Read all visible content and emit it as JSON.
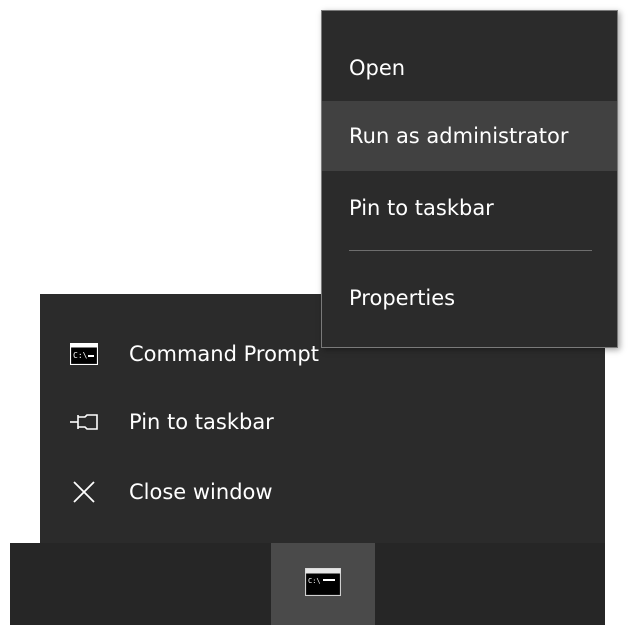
{
  "context_menu": {
    "items": [
      {
        "label": "Open"
      },
      {
        "label": "Run as administrator"
      },
      {
        "label": "Pin to taskbar"
      },
      {
        "label": "Properties"
      }
    ],
    "highlighted_item": "Run as administrator"
  },
  "jump_list": {
    "items": [
      {
        "label": "Command Prompt",
        "icon": "command-prompt-icon"
      },
      {
        "label": "Pin to taskbar",
        "icon": "pin-icon"
      },
      {
        "label": "Close window",
        "icon": "close-icon"
      }
    ]
  },
  "taskbar": {
    "active_app_icon": "command-prompt-icon"
  },
  "colors": {
    "menu_bg": "#2b2b2b",
    "menu_hover": "#414141",
    "menu_border": "#7a7a7a",
    "taskbar_bg": "#262626",
    "taskbar_active": "#4a4a4a",
    "text": "#ffffff"
  }
}
